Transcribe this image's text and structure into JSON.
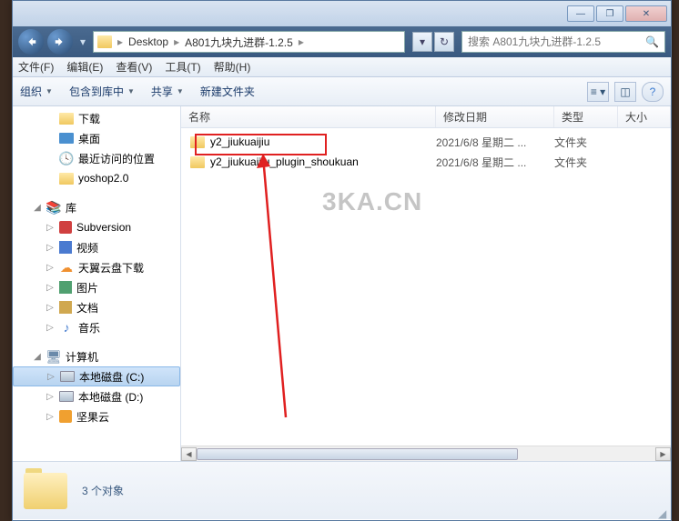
{
  "titlebar": {
    "min": "—",
    "max": "❐",
    "close": "✕"
  },
  "breadcrumb": {
    "item1": "Desktop",
    "item2": "A801九块九进群-1.2.5"
  },
  "search": {
    "placeholder": "搜索 A801九块九进群-1.2.5",
    "icon": "🔍"
  },
  "menu": {
    "file": "文件(F)",
    "edit": "编辑(E)",
    "view": "查看(V)",
    "tools": "工具(T)",
    "help": "帮助(H)"
  },
  "toolbar": {
    "organize": "组织",
    "include": "包含到库中",
    "share": "共享",
    "newfolder": "新建文件夹"
  },
  "sidebar": {
    "downloads": "下载",
    "desktop": "桌面",
    "recent": "最近访问的位置",
    "yoshop": "yoshop2.0",
    "library": "库",
    "subversion": "Subversion",
    "video": "视频",
    "tianyi": "天翼云盘下载",
    "pictures": "图片",
    "documents": "文档",
    "music": "音乐",
    "computer": "计算机",
    "drivec": "本地磁盘 (C:)",
    "drived": "本地磁盘 (D:)",
    "jianguo": "坚果云"
  },
  "columns": {
    "name": "名称",
    "modified": "修改日期",
    "type": "类型",
    "size": "大小"
  },
  "files": {
    "row1": {
      "name": "y2_jiukuaijiu",
      "date": "2021/6/8 星期二 ...",
      "type": "文件夹"
    },
    "row2": {
      "name": "y2_jiukuaijiu_plugin_shoukuan",
      "date": "2021/6/8 星期二 ...",
      "type": "文件夹"
    }
  },
  "status": {
    "text": "3 个对象"
  },
  "watermark": "3KA.CN"
}
